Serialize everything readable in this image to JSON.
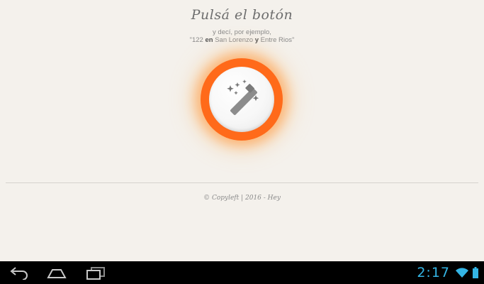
{
  "app": {
    "title": "Pulsá el botón",
    "subtitle_line1": "y decí, por ejemplo,",
    "subtitle_line2": {
      "quote_open": "\"122 ",
      "kw_en": "en",
      "mid": " San Lorenzo ",
      "kw_y": "y",
      "end": " Entre Rios\""
    },
    "footer": "© Copyleft | 2016 - Hey"
  },
  "icons": {
    "magic_button": "magic-wand-icon",
    "back": "back-icon",
    "home": "home-icon",
    "recent": "recent-apps-icon",
    "wifi": "wifi-icon",
    "battery": "battery-icon"
  },
  "colors": {
    "accent": "#ff6a1a",
    "clock": "#34b5e5",
    "background": "#f4f1ec"
  },
  "statusbar": {
    "time": "2:17"
  }
}
